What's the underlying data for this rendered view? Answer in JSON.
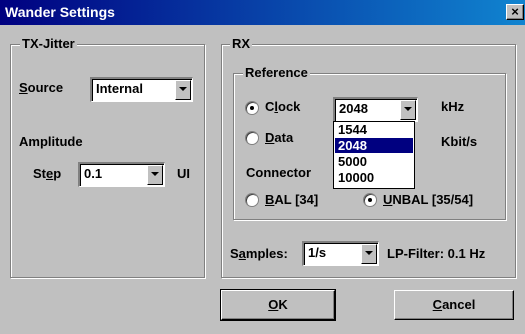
{
  "window": {
    "title": "Wander Settings",
    "close_glyph": "×"
  },
  "tx_jitter": {
    "group_label": "TX-Jitter",
    "source_label": "Source",
    "source_value": "Internal",
    "amplitude_label": "Amplitude",
    "step_label": "Step",
    "step_value": "0.1",
    "step_unit": "UI"
  },
  "rx": {
    "group_label": "RX",
    "reference": {
      "group_label": "Reference",
      "clock_label": "Clock",
      "clock_selected": true,
      "clock_value": "2048",
      "clock_unit": "kHz",
      "clock_options": [
        "1544",
        "2048",
        "5000",
        "10000"
      ],
      "clock_highlighted": "2048",
      "data_label": "Data",
      "data_selected": false,
      "data_unit": "Kbit/s",
      "connector_label": "Connector",
      "bal_label": "BAL [34]",
      "bal_selected": false,
      "unbal_label": "UNBAL [35/54]",
      "unbal_selected": true
    },
    "samples_label": "Samples:",
    "samples_value": "1/s",
    "lp_filter_label": "LP-Filter: 0.1 Hz"
  },
  "buttons": {
    "ok_label": "OK",
    "cancel_label": "Cancel"
  },
  "colors": {
    "titlebar": "#000080",
    "face": "#c0c0c0",
    "highlight": "#000080"
  }
}
